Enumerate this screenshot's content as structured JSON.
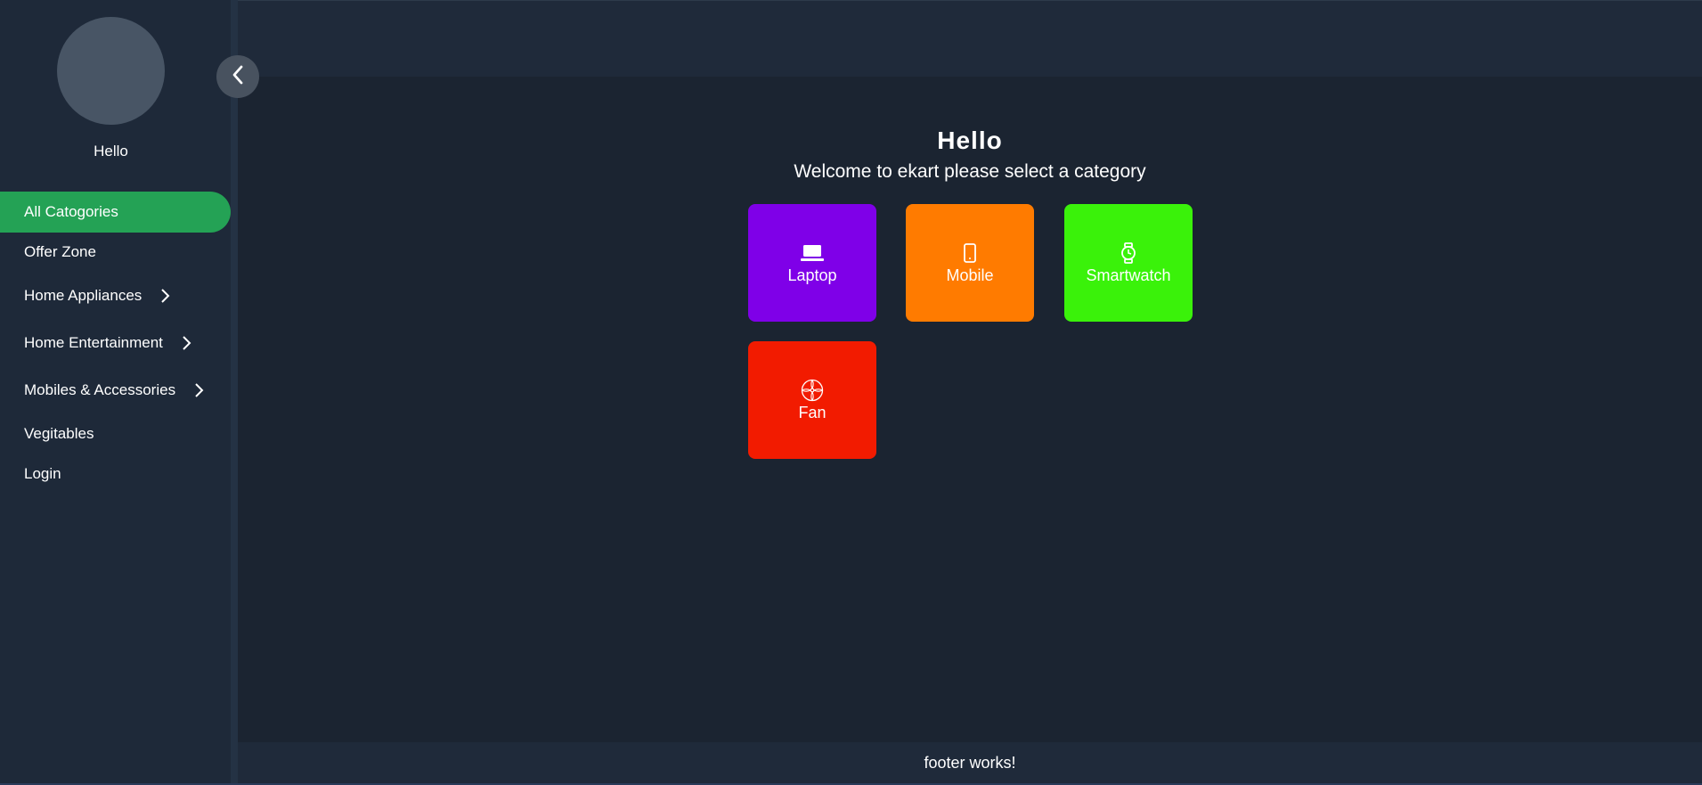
{
  "sidebar": {
    "user_name": "Hello",
    "items": [
      {
        "label": "All Catogories",
        "active": true,
        "has_children": false
      },
      {
        "label": "Offer Zone",
        "active": false,
        "has_children": false
      },
      {
        "label": "Home Appliances",
        "active": false,
        "has_children": true
      },
      {
        "label": "Home Entertainment",
        "active": false,
        "has_children": true
      },
      {
        "label": "Mobiles & Accessories",
        "active": false,
        "has_children": true
      },
      {
        "label": "Vegitables",
        "active": false,
        "has_children": false
      },
      {
        "label": "Login",
        "active": false,
        "has_children": false
      }
    ]
  },
  "main": {
    "title": "Hello",
    "subtitle": "Welcome to ekart please select a category",
    "categories": [
      {
        "label": "Laptop",
        "icon": "laptop-icon",
        "color": "#7f00e8"
      },
      {
        "label": "Mobile",
        "icon": "mobile-icon",
        "color": "#ff7b00"
      },
      {
        "label": "Smartwatch",
        "icon": "smartwatch-icon",
        "color": "#3af20a"
      },
      {
        "label": "Fan",
        "icon": "fan-icon",
        "color": "#f21b00"
      }
    ]
  },
  "footer": {
    "text": "footer works!"
  },
  "colors": {
    "active_nav": "#24a255",
    "background": "#1b2431",
    "sidebar": "#1e2939"
  }
}
